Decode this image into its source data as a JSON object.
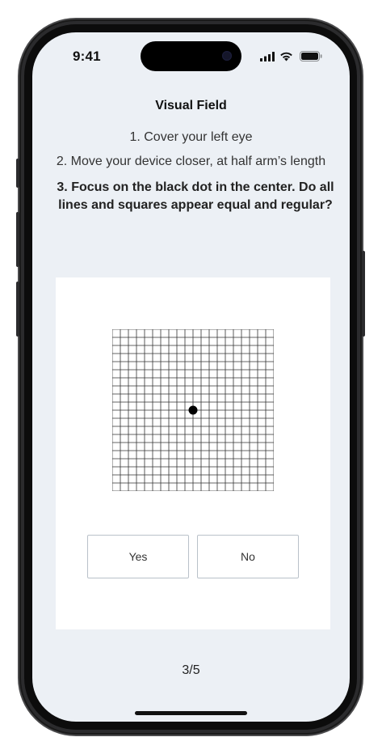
{
  "status_bar": {
    "time": "9:41",
    "icons": [
      "cellular-signal-icon",
      "wifi-icon",
      "battery-icon"
    ]
  },
  "screen": {
    "title": "Visual Field",
    "steps": [
      "1. Cover your left eye",
      "2. Move your device closer, at half arm’s length",
      "3. Focus on the black dot in the center. Do all lines and squares appear equal and regular?"
    ]
  },
  "amsler_grid": {
    "rows": 20,
    "columns": 20,
    "line_color": "#333333",
    "dot_color": "#000000"
  },
  "buttons": {
    "yes_label": "Yes",
    "no_label": "No"
  },
  "progress": {
    "label": "3/5",
    "current": 3,
    "total": 5
  },
  "colors": {
    "screen_background": "#ecf0f5",
    "card_background": "#ffffff",
    "button_border": "#b9c1c9"
  }
}
